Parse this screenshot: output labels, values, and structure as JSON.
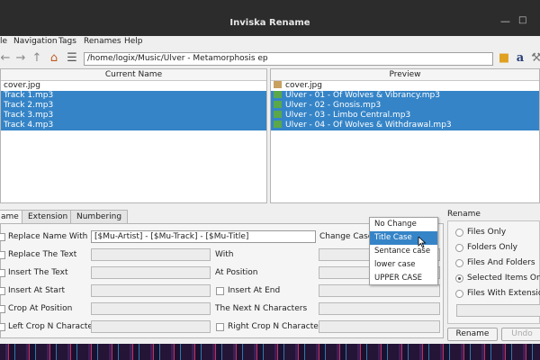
{
  "window": {
    "title": "Inviska Rename"
  },
  "menu": [
    "le",
    "Navigation",
    "Tags",
    "Renames",
    "Help"
  ],
  "toolbar": {
    "path": "/home/logix/Music/Ulver - Metamorphosis ep",
    "icons": [
      "back-arrow-icon",
      "forward-arrow-icon",
      "up-arrow-icon",
      "home-icon",
      "folder-icon",
      "font-a-icon",
      "wrench-icon"
    ]
  },
  "panes": {
    "current": {
      "header": "Current Name",
      "rows": [
        {
          "name": "cover.jpg",
          "selected": false
        },
        {
          "name": "Track 1.mp3",
          "selected": true
        },
        {
          "name": "Track 2.mp3",
          "selected": true
        },
        {
          "name": "Track 3.mp3",
          "selected": true
        },
        {
          "name": "Track 4.mp3",
          "selected": true
        }
      ]
    },
    "preview": {
      "header": "Preview",
      "rows": [
        {
          "name": "cover.jpg",
          "selected": false
        },
        {
          "name": "Ulver - 01 - Of Wolves & Vibrancy.mp3",
          "selected": true
        },
        {
          "name": "Ulver - 02 - Gnosis.mp3",
          "selected": true
        },
        {
          "name": "Ulver - 03 - Limbo Central.mp3",
          "selected": true
        },
        {
          "name": "Ulver - 04 - Of Wolves & Withdrawal.mp3",
          "selected": true
        }
      ]
    }
  },
  "tabs": [
    "ame",
    "Extension",
    "Numbering"
  ],
  "form": {
    "replace_name_with": "Replace Name With",
    "replace_name_value": "[$Mu-Artist] - [$Mu-Track] - [$Mu-Title]",
    "change_case": "Change Case",
    "replace_the_text": "Replace The Text",
    "with": "With",
    "insert_the_text": "Insert The Text",
    "at_position": "At Position",
    "insert_at_start": "Insert At Start",
    "insert_at_end": "Insert At End",
    "crop_at_position": "Crop At Position",
    "next_n_characters": "The Next N Characters",
    "left_crop": "Left Crop N Characters",
    "right_crop": "Right Crop N Characters"
  },
  "case_options": [
    "No Change",
    "Title Case",
    "Sentance case",
    "lower case",
    "UPPER CASE"
  ],
  "case_selected": "Title Case",
  "rename_group": {
    "title": "Rename",
    "options": [
      "Files Only",
      "Folders Only",
      "Files And Folders",
      "Selected Items Only",
      "Files With Extensions"
    ],
    "selected": "Selected Items Only",
    "rename_button": "Rename",
    "undo_button": "Undo"
  },
  "colors": {
    "selection": "#3584c7",
    "titlebar": "#2c2c2c",
    "window": "#efefef"
  }
}
